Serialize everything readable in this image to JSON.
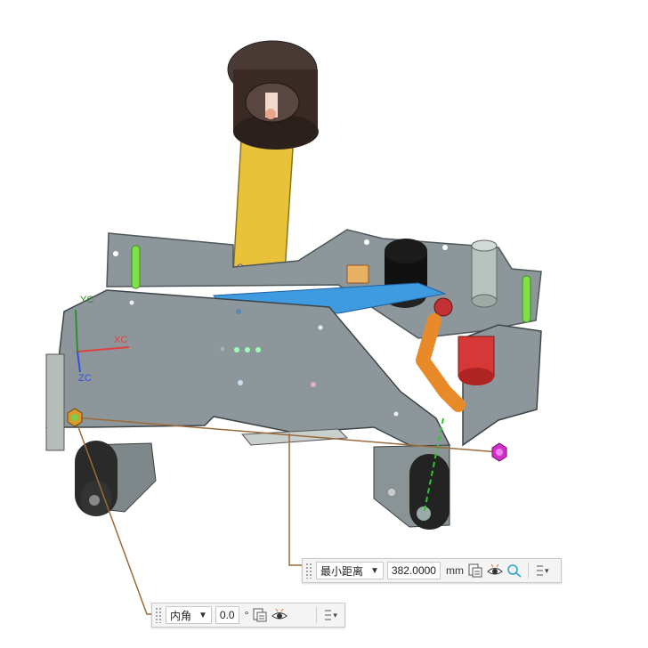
{
  "axes": {
    "x_label": "XC",
    "y_label": "YC",
    "z_label": "ZC"
  },
  "distance_tool": {
    "mode": "最小距离",
    "value": "382.0000",
    "unit": "mm"
  },
  "angle_tool": {
    "mode": "内角",
    "value": "0.0",
    "unit": "°"
  },
  "colors": {
    "frame": "#8d979b",
    "frame_dark": "#6b7478",
    "yellow_arm": "#e8c33a",
    "orange_arm": "#e88a2a",
    "blue_belt": "#3e9be0",
    "green_rod": "#7fe04a",
    "spool": "#3a2a25",
    "leader_line": "#9a6a3a",
    "magenta_marker": "#d030c8"
  }
}
